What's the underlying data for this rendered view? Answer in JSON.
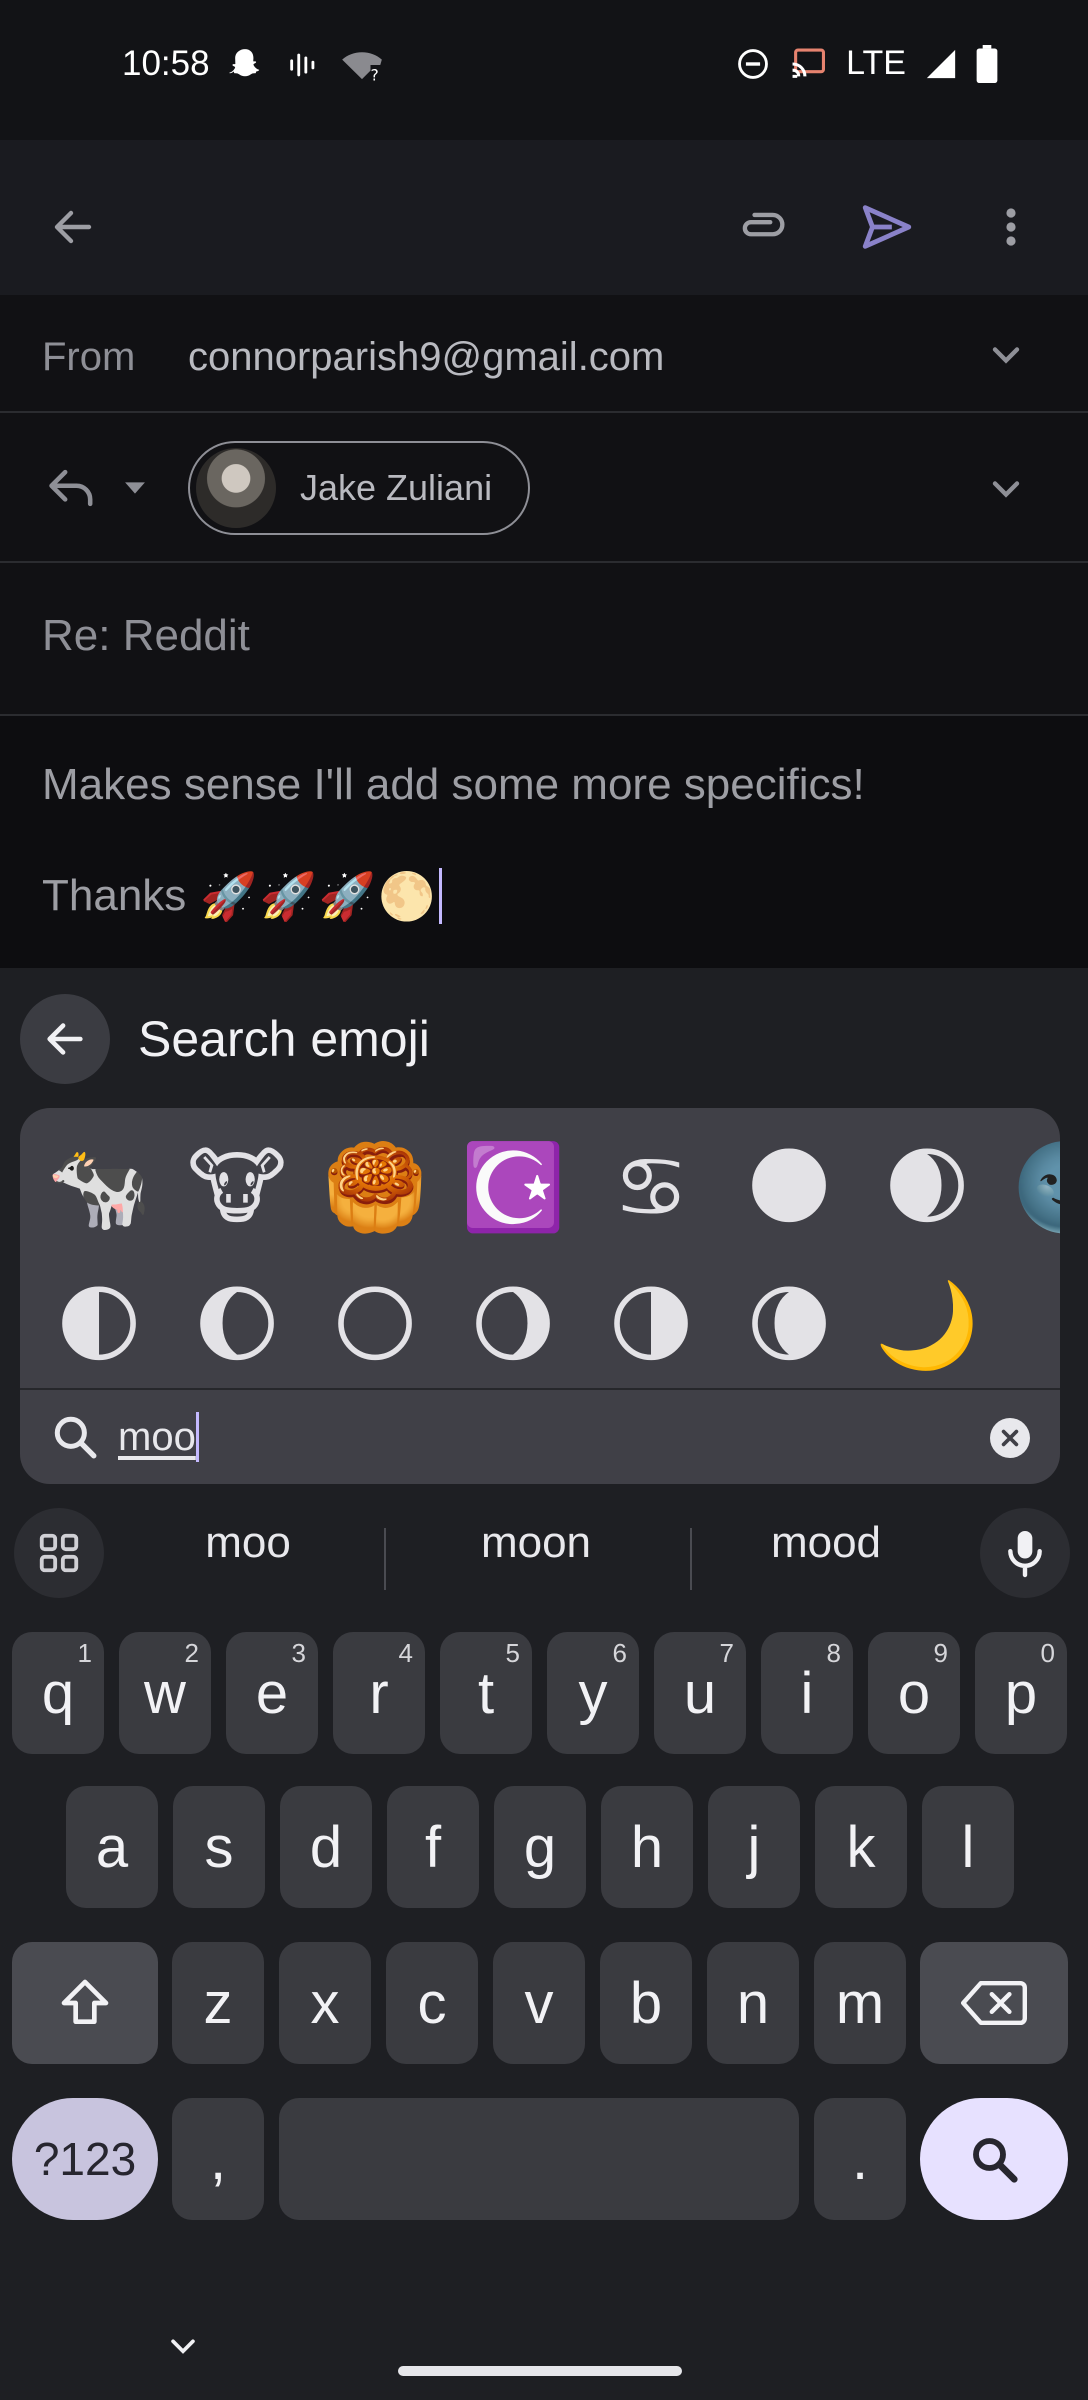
{
  "status_bar": {
    "time": "10:58",
    "network": "LTE",
    "icons": [
      "snapchat-icon",
      "voicemail-icon",
      "wifi-question-icon",
      "do-not-disturb-icon",
      "cast-icon",
      "signal-icon",
      "battery-icon"
    ]
  },
  "app_bar": {
    "icons": [
      "back-arrow-icon",
      "paperclip-icon",
      "send-icon",
      "more-vert-icon"
    ]
  },
  "compose": {
    "from_label": "From",
    "from_value": "connorparish9@gmail.com",
    "recipient_name": "Jake Zuliani",
    "subject": "Re: Reddit",
    "body_line1": "Makes sense I'll add some more specifics!",
    "body_line2_text": "Thanks",
    "body_line2_emojis": "🚀🚀🚀🌕"
  },
  "keyboard": {
    "search_title": "Search emoji",
    "search_value": "moo",
    "emoji_results": [
      "🐄",
      "🐮",
      "🥮",
      "☪️",
      "♋",
      "🌑",
      "🌒",
      "🌚",
      "🌓",
      "🌔",
      "🌕",
      "🌖",
      "🌗",
      "🌘",
      "🌙"
    ],
    "suggestions": [
      "moo",
      "moon",
      "mood"
    ],
    "row1": [
      {
        "key": "q",
        "hint": "1"
      },
      {
        "key": "w",
        "hint": "2"
      },
      {
        "key": "e",
        "hint": "3"
      },
      {
        "key": "r",
        "hint": "4"
      },
      {
        "key": "t",
        "hint": "5"
      },
      {
        "key": "y",
        "hint": "6"
      },
      {
        "key": "u",
        "hint": "7"
      },
      {
        "key": "i",
        "hint": "8"
      },
      {
        "key": "o",
        "hint": "9"
      },
      {
        "key": "p",
        "hint": "0"
      }
    ],
    "row2": [
      "a",
      "s",
      "d",
      "f",
      "g",
      "h",
      "j",
      "k",
      "l"
    ],
    "row3": [
      "z",
      "x",
      "c",
      "v",
      "b",
      "n",
      "m"
    ],
    "symbols_label": "?123",
    "comma": ",",
    "period": ".",
    "accent_color": "#e7e1ff"
  }
}
